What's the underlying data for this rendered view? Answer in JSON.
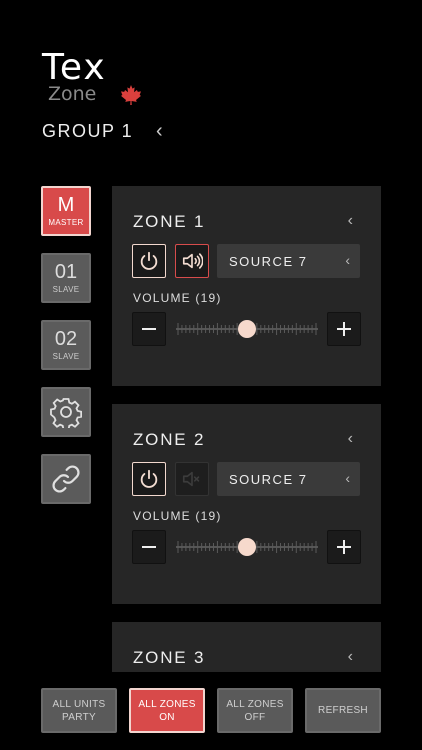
{
  "logo": {
    "primary": "Tex",
    "secondary": "Zone"
  },
  "group": {
    "title": "GROUP 1"
  },
  "side_buttons": [
    {
      "big": "M",
      "small": "MASTER",
      "active": true
    },
    {
      "big": "01",
      "small": "SLAVE",
      "active": false
    },
    {
      "big": "02",
      "small": "SLAVE",
      "active": false
    }
  ],
  "zones": [
    {
      "title": "ZONE 1",
      "source": "SOURCE 7",
      "volume_label": "VOLUME (19)",
      "volume_fraction": 0.5,
      "muted_active": true
    },
    {
      "title": "ZONE 2",
      "source": "SOURCE 7",
      "volume_label": "VOLUME (19)",
      "volume_fraction": 0.5,
      "muted_active": false
    },
    {
      "title": "ZONE 3"
    }
  ],
  "bottom": {
    "all_units_party": "ALL UNITS\nPARTY",
    "all_zones_on": "ALL ZONES\nON",
    "all_zones_off": "ALL ZONES\nOFF",
    "refresh": "REFRESH"
  },
  "colors": {
    "accent": "#d84a4a",
    "knob": "#f6d9cc",
    "card": "#262626"
  },
  "icons": [
    "maple-leaf-icon",
    "chevron-left-icon",
    "power-icon",
    "speaker-icon",
    "minus-icon",
    "plus-icon",
    "gear-icon",
    "link-icon"
  ]
}
